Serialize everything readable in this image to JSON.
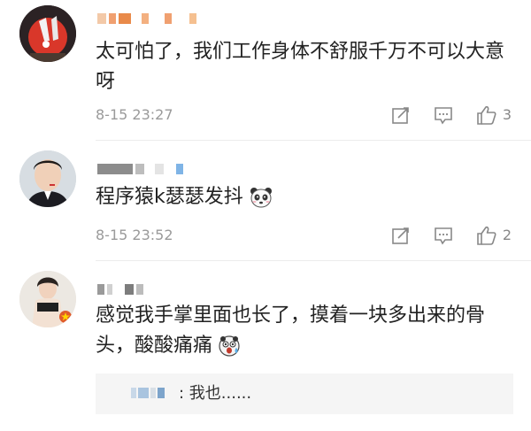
{
  "comments": [
    {
      "text": "太可怕了，我们工作身体不舒服千万不可以大意呀",
      "time": "8-15 23:27",
      "likes": "3",
      "avatar": "rabbit-avatar"
    },
    {
      "text": "程序猿k瑟瑟发抖",
      "time": "8-15 23:52",
      "likes": "2",
      "avatar": "man-avatar",
      "emoji": "panda-emoji"
    },
    {
      "text": "感觉我手掌里面也长了，摸着一块多出来的骨头，酸酸痛痛",
      "avatar": "woman-avatar",
      "emoji": "scared-emoji",
      "reply": {
        "text": ":  我也......"
      }
    }
  ],
  "icons": {
    "share": "share-icon",
    "comment": "comment-icon",
    "like": "thumbs-up-icon"
  }
}
